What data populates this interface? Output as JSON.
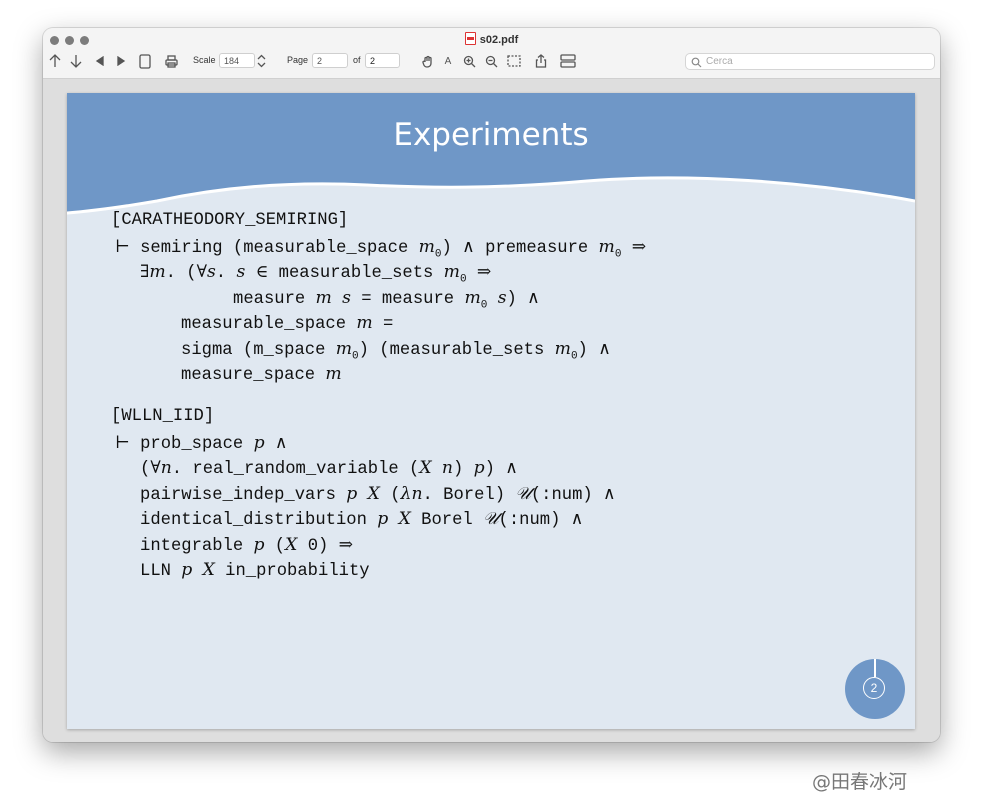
{
  "window": {
    "title": "s02.pdf"
  },
  "toolbar": {
    "scale_label": "Scale",
    "scale_value": "184",
    "page_label": "Page",
    "page_value": "2",
    "of_label": "of",
    "total_pages": "2",
    "search_placeholder": "Cerca"
  },
  "slide": {
    "title": "Experiments",
    "page_number": "2",
    "lines": [
      "[CARATHEODORY_SEMIRING]",
      "⊢ semiring (measurable_space m₀) ∧ premeasure m₀ ⇒",
      "∃m. (∀s. s ∈ measurable_sets m₀ ⇒",
      "measure m s = measure m₀ s) ∧",
      "measurable_space m =",
      "sigma (m_space m₀) (measurable_sets m₀) ∧",
      "measure_space m",
      "[WLLN_IID]",
      "⊢ prob_space p ∧",
      "(∀n. real_random_variable (X n) p) ∧",
      "pairwise_indep_vars p X (λn. Borel) 𝒰(:num) ∧",
      "identical_distribution p X Borel 𝒰(:num) ∧",
      "integrable p (X 0) ⇒",
      "LLN p X in_probability"
    ]
  },
  "watermark": "@田春冰河"
}
